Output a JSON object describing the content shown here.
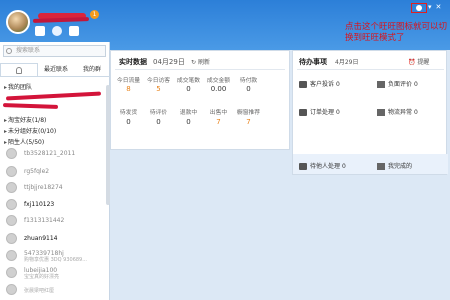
{
  "header": {
    "badge_count": "1",
    "settings_icon": "gear-icon",
    "window_controls": [
      "▾",
      "✕"
    ]
  },
  "annotation": {
    "text": "点击这个旺旺图标就可以切换到旺旺模式了"
  },
  "sidebar": {
    "search_placeholder": "搜索联系",
    "tabs": [
      "",
      "最近联系",
      "我的群"
    ],
    "groups": [
      {
        "label": "我的团队"
      },
      {
        "label": "淘宝好友(1/8)"
      },
      {
        "label": "未分组好友(0/10)"
      },
      {
        "label": "陌生人(5/50)"
      }
    ],
    "contacts": [
      {
        "name": "tb3528121_2011",
        "sub": ""
      },
      {
        "name": "rg5fqle2",
        "sub": ""
      },
      {
        "name": "ttjbjjre18274",
        "sub": ""
      },
      {
        "name": "fxj110123",
        "sub": ""
      },
      {
        "name": "f1313131442",
        "sub": ""
      },
      {
        "name": "zhuan9114",
        "sub": ""
      },
      {
        "name": "547339718hj",
        "sub": "购物享优惠 3DQ 930689..."
      },
      {
        "name": "lubeijia100",
        "sub": "宝宝真的好漂亮"
      },
      {
        "name": "",
        "sub": "张晨梁吧红厘"
      }
    ]
  },
  "realtime": {
    "title": "实时数据",
    "date": "04月29日",
    "refresh": "刷新",
    "row1": [
      {
        "label": "今日流量",
        "value": "8"
      },
      {
        "label": "今日访客",
        "value": "5"
      },
      {
        "label": "成交笔数",
        "value": "0"
      },
      {
        "label": "成交金额",
        "value": "0.00"
      },
      {
        "label": "待付款",
        "value": "0"
      }
    ],
    "row2": [
      {
        "label": "待发货",
        "value": "0"
      },
      {
        "label": "待评价",
        "value": "0"
      },
      {
        "label": "退款中",
        "value": "0"
      },
      {
        "label": "出售中",
        "value": "7"
      },
      {
        "label": "橱窗推荐",
        "value": "7"
      }
    ]
  },
  "todo": {
    "title": "待办事项",
    "date": "4月29日",
    "refresh": "提醒",
    "items": [
      {
        "label": "客户投诉",
        "value": "0"
      },
      {
        "label": "负面评价",
        "value": "0"
      },
      {
        "label": "订单处理",
        "value": "0"
      },
      {
        "label": "物流异常",
        "value": "0"
      },
      {
        "label": "待他人处理",
        "value": "0"
      },
      {
        "label": "我完成的",
        "value": ""
      }
    ]
  }
}
